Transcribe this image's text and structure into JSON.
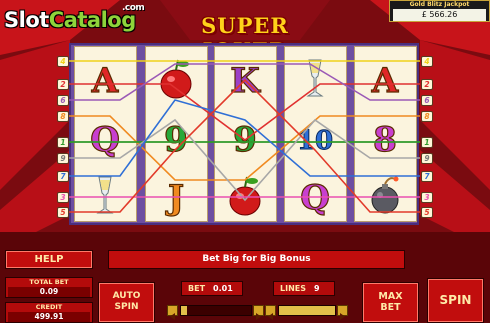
{
  "watermark": {
    "part1": "Slot",
    "part2": "Catalog",
    "part3": ".com"
  },
  "game_title": "SUPER JOKER",
  "jackpot": {
    "label": "Gold Blitz Jackpot",
    "value": "£ 566.26"
  },
  "reels": [
    [
      "A",
      "Q",
      "bubbly"
    ],
    [
      "cherry-9",
      "9",
      "J"
    ],
    [
      "K",
      "9",
      "cherry"
    ],
    [
      "bubbly",
      "10",
      "Q"
    ],
    [
      "A",
      "8",
      "bomb"
    ]
  ],
  "paylines_left": [
    "4",
    "2",
    "6",
    "8",
    "1",
    "9",
    "7",
    "3",
    "5"
  ],
  "paylines_right": [
    "4",
    "2",
    "6",
    "8",
    "1",
    "9",
    "7",
    "3",
    "5"
  ],
  "paylines_colors": {
    "1": "#2f9a2a",
    "2": "#e03030",
    "3": "#e94fb0",
    "4": "#f0d21a",
    "5": "#e23a2a",
    "6": "#9b59b6",
    "7": "#2f6fd6",
    "8": "#f08a20",
    "9": "#7a7a7a"
  },
  "buttons": {
    "help": "HELP",
    "auto_spin_1": "AUTO",
    "auto_spin_2": "SPIN",
    "max_bet_1": "MAX",
    "max_bet_2": "BET",
    "spin": "SPIN"
  },
  "message": "Bet Big for Big Bonus",
  "total_bet": {
    "label": "TOTAL BET",
    "value": "0.09"
  },
  "credit": {
    "label": "CREDIT",
    "value": "499.91"
  },
  "bet": {
    "label": "BET",
    "value": "0.01"
  },
  "lines": {
    "label": "LINES",
    "value": "9"
  },
  "bet_slider_level": 0.05,
  "lines_slider_level": 1.0
}
